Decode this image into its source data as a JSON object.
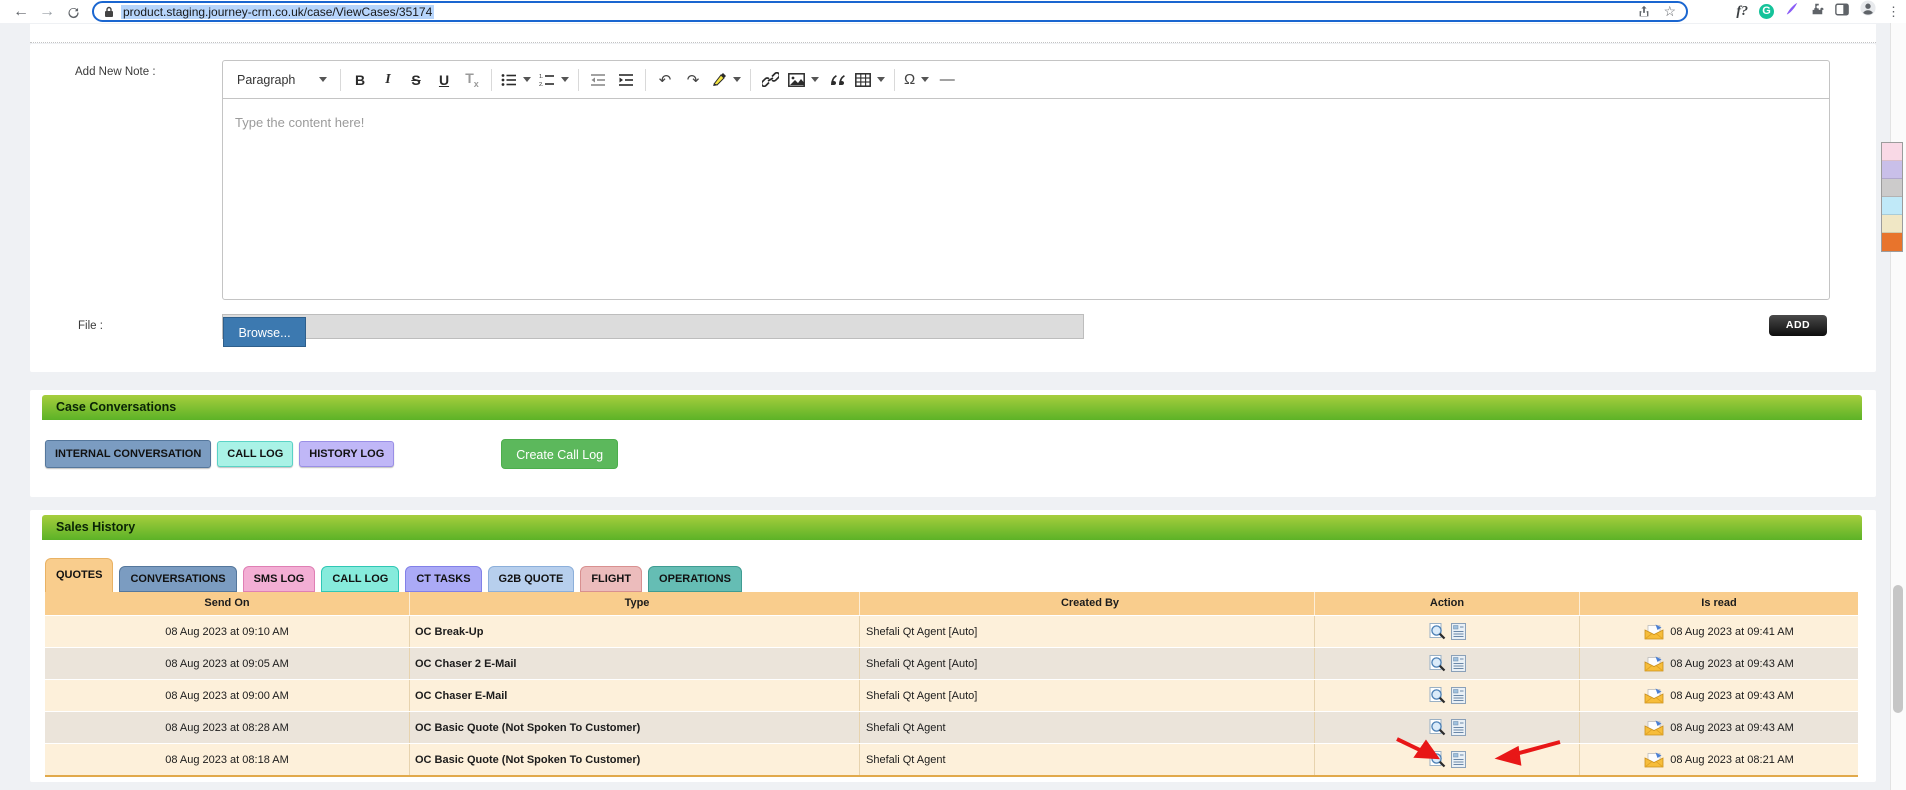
{
  "browser": {
    "url": "product.staging.journey-crm.co.uk/case/ViewCases/35174",
    "extension_glyphs": {
      "font_tool": "f?",
      "grammarly": "G",
      "menu_dots": "⋮"
    },
    "nav_glyphs": {
      "back": "←",
      "forward": "→",
      "star": "☆"
    }
  },
  "note_section": {
    "label": "Add New Note :",
    "editor": {
      "paragraph_dropdown": "Paragraph",
      "placeholder": "Type the content here!",
      "toolbar": [
        {
          "name": "paragraph-style",
          "label": "Paragraph",
          "dropdown": true
        },
        "|",
        {
          "name": "bold",
          "glyph": "B",
          "style": ""
        },
        {
          "name": "italic",
          "glyph": "I",
          "style": "g-italic"
        },
        {
          "name": "strikethrough",
          "glyph": "S",
          "style": "g-strike"
        },
        {
          "name": "underline",
          "glyph": "U",
          "style": "g-under"
        },
        {
          "name": "remove-format",
          "glyph": "T",
          "sub": "x",
          "style": "g-removefmt"
        },
        "|",
        {
          "name": "bulleted-list",
          "icon": "list-bullet",
          "dropdown": true
        },
        {
          "name": "numbered-list",
          "icon": "list-number",
          "dropdown": true
        },
        "|",
        {
          "name": "outdent",
          "icon": "outdent"
        },
        {
          "name": "indent",
          "icon": "indent"
        },
        "|",
        {
          "name": "undo",
          "glyph": "↶",
          "style": "g-arrow"
        },
        {
          "name": "redo",
          "glyph": "↷",
          "style": "g-arrow"
        },
        {
          "name": "highlight",
          "icon": "highlight",
          "dropdown": true
        },
        "|",
        {
          "name": "link",
          "icon": "link"
        },
        {
          "name": "insert-image",
          "icon": "image",
          "dropdown": true
        },
        {
          "name": "block-quote",
          "icon": "quote"
        },
        {
          "name": "insert-table",
          "icon": "table",
          "dropdown": true
        },
        "|",
        {
          "name": "special-characters",
          "glyph": "Ω",
          "style": "g-arrow",
          "dropdown": true
        },
        {
          "name": "horizontal-line",
          "glyph": "—",
          "style": "g-arrow"
        }
      ]
    },
    "file_label": "File :",
    "browse_button": "Browse...",
    "add_button": "ADD"
  },
  "case_conversations": {
    "title": "Case Conversations",
    "buttons": [
      {
        "label": "INTERNAL CONVERSATION",
        "bg": "#7b9cc1",
        "border": "#55779c",
        "big": true
      },
      {
        "label": "CALL LOG",
        "bg": "#a9f2e6",
        "border": "#5ad3c6",
        "big": false
      },
      {
        "label": "HISTORY LOG",
        "bg": "#c0b7f7",
        "border": "#9a8fe6",
        "big": false
      }
    ],
    "create_call_log": "Create Call Log"
  },
  "sales_history": {
    "title": "Sales History",
    "tabs": [
      {
        "label": "QUOTES",
        "bg": "#f9cd8d",
        "border": "#e9b264",
        "active": true
      },
      {
        "label": "CONVERSATIONS",
        "bg": "#7b9cc1",
        "border": "#55779c",
        "active": false
      },
      {
        "label": "SMS LOG",
        "bg": "#f3aed4",
        "border": "#df7fb4",
        "active": false
      },
      {
        "label": "CALL LOG",
        "bg": "#86ebdc",
        "border": "#30c7b5",
        "active": false
      },
      {
        "label": "CT TASKS",
        "bg": "#abaaf6",
        "border": "#8280e8",
        "active": false
      },
      {
        "label": "G2B QUOTE",
        "bg": "#b7cfed",
        "border": "#8cafda",
        "active": false
      },
      {
        "label": "FLIGHT",
        "bg": "#ecbcbc",
        "border": "#d89090",
        "active": false
      },
      {
        "label": "OPERATIONS",
        "bg": "#65bdb4",
        "border": "#3f9c92",
        "active": false
      }
    ],
    "table": {
      "columns": [
        "Send On",
        "Type",
        "Created By",
        "Action",
        "Is read"
      ],
      "rows": [
        {
          "send_on": "08 Aug 2023 at 09:10 AM",
          "type": "OC Break-Up",
          "created_by": "Shefali Qt Agent [Auto]",
          "is_read": "08 Aug 2023 at 09:41 AM"
        },
        {
          "send_on": "08 Aug 2023 at 09:05 AM",
          "type": "OC Chaser 2 E-Mail",
          "created_by": "Shefali Qt Agent [Auto]",
          "is_read": "08 Aug 2023 at 09:43 AM"
        },
        {
          "send_on": "08 Aug 2023 at 09:00 AM",
          "type": "OC Chaser E-Mail",
          "created_by": "Shefali Qt Agent [Auto]",
          "is_read": "08 Aug 2023 at 09:43 AM"
        },
        {
          "send_on": "08 Aug 2023 at 08:28 AM",
          "type": "OC Basic Quote (Not Spoken To Customer)",
          "created_by": "Shefali Qt Agent",
          "is_read": "08 Aug 2023 at 09:43 AM"
        },
        {
          "send_on": "08 Aug 2023 at 08:18 AM",
          "type": "OC Basic Quote (Not Spoken To Customer)",
          "created_by": "Shefali Qt Agent",
          "is_read": "08 Aug 2023 at 08:21 AM"
        }
      ]
    }
  },
  "side_swatches": [
    "#f9d9e6",
    "#c9bfe9",
    "#cccbcb",
    "#c0e9f8",
    "#f0e7c5",
    "#e8742c"
  ],
  "colors": {
    "green_bar_top": "#a6ce3d",
    "green_bar_bottom": "#5cb227",
    "table_header": "#f9cd8d",
    "row_odd": "#fdf0da",
    "row_even": "#ebe4da",
    "url_selection": "#b7d5fb",
    "annotation_arrow": "#e81717",
    "browse_button": "#3c79b0",
    "create_button": "#5cb85c"
  }
}
